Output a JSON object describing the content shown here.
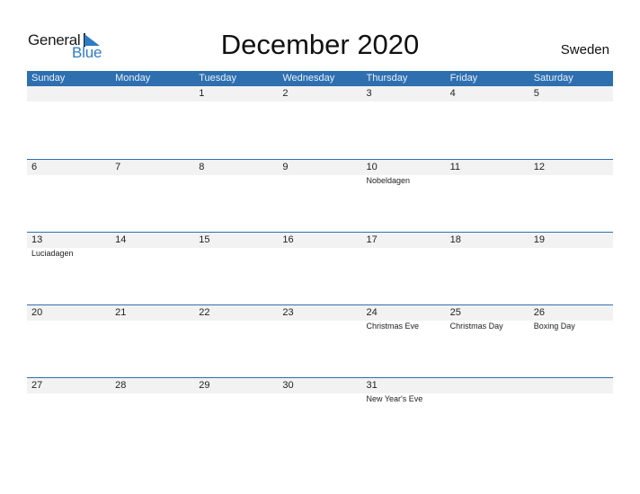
{
  "logo": {
    "general": "General",
    "blue": "Blue",
    "icon": "triangle-flag-icon"
  },
  "title": "December 2020",
  "country": "Sweden",
  "weekdays": [
    "Sunday",
    "Monday",
    "Tuesday",
    "Wednesday",
    "Thursday",
    "Friday",
    "Saturday"
  ],
  "weeks": [
    [
      {
        "n": "",
        "e": ""
      },
      {
        "n": "",
        "e": ""
      },
      {
        "n": "1",
        "e": ""
      },
      {
        "n": "2",
        "e": ""
      },
      {
        "n": "3",
        "e": ""
      },
      {
        "n": "4",
        "e": ""
      },
      {
        "n": "5",
        "e": ""
      }
    ],
    [
      {
        "n": "6",
        "e": ""
      },
      {
        "n": "7",
        "e": ""
      },
      {
        "n": "8",
        "e": ""
      },
      {
        "n": "9",
        "e": ""
      },
      {
        "n": "10",
        "e": "Nobeldagen"
      },
      {
        "n": "11",
        "e": ""
      },
      {
        "n": "12",
        "e": ""
      }
    ],
    [
      {
        "n": "13",
        "e": "Luciadagen"
      },
      {
        "n": "14",
        "e": ""
      },
      {
        "n": "15",
        "e": ""
      },
      {
        "n": "16",
        "e": ""
      },
      {
        "n": "17",
        "e": ""
      },
      {
        "n": "18",
        "e": ""
      },
      {
        "n": "19",
        "e": ""
      }
    ],
    [
      {
        "n": "20",
        "e": ""
      },
      {
        "n": "21",
        "e": ""
      },
      {
        "n": "22",
        "e": ""
      },
      {
        "n": "23",
        "e": ""
      },
      {
        "n": "24",
        "e": "Christmas Eve"
      },
      {
        "n": "25",
        "e": "Christmas Day"
      },
      {
        "n": "26",
        "e": "Boxing Day"
      }
    ],
    [
      {
        "n": "27",
        "e": ""
      },
      {
        "n": "28",
        "e": ""
      },
      {
        "n": "29",
        "e": ""
      },
      {
        "n": "30",
        "e": ""
      },
      {
        "n": "31",
        "e": "New Year's Eve"
      },
      {
        "n": "",
        "e": ""
      },
      {
        "n": "",
        "e": ""
      }
    ]
  ],
  "colors": {
    "header_bg": "#2e6fb0",
    "accent_blue": "#2e7bc4",
    "row_band": "#f2f2f2"
  }
}
